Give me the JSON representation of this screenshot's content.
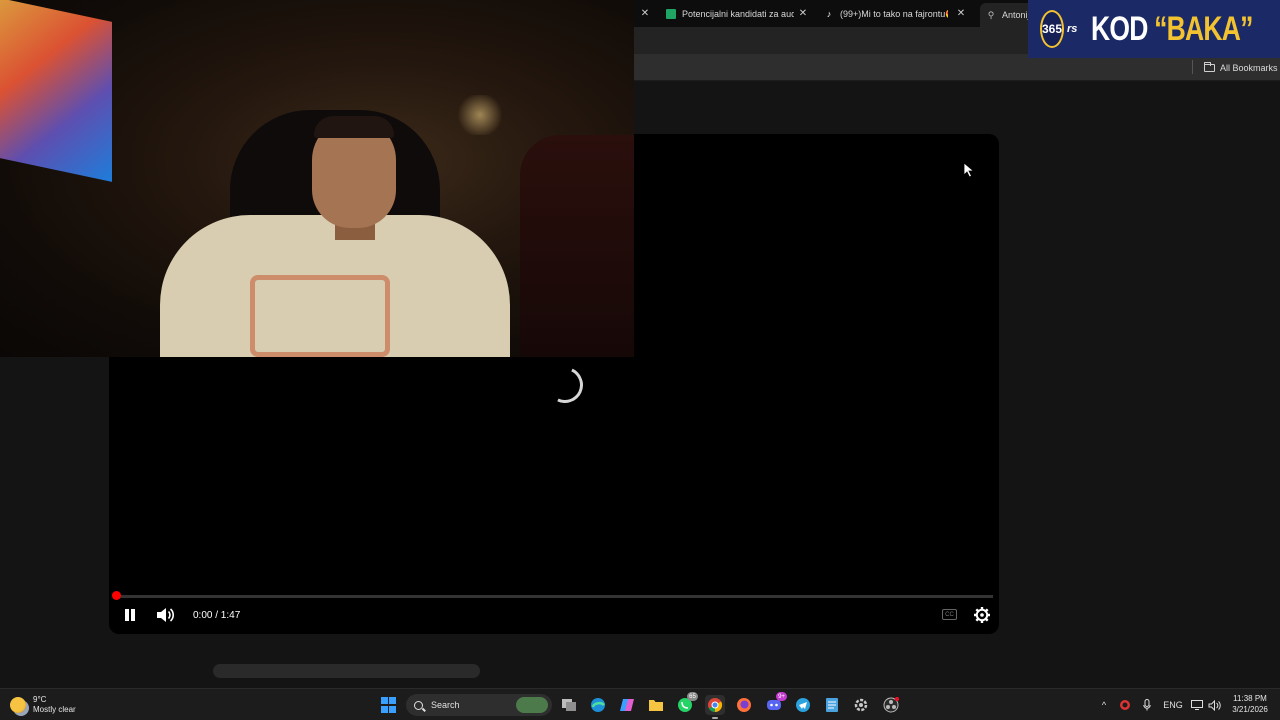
{
  "browser": {
    "tabs": [
      {
        "title": "Potencijalni kandidati za audicij",
        "icon": "google-sheets-icon"
      },
      {
        "title": "(99+)Mi to tako na fajrontu😍",
        "icon": "tiktok-icon"
      },
      {
        "title": "Antonijo",
        "icon": "link-icon"
      }
    ],
    "all_bookmarks_label": "All Bookmarks"
  },
  "brand": {
    "logo_number": "365",
    "logo_suffix": "rs",
    "title_white": "KOD ",
    "title_yellow": "“BAKA”",
    "colors": {
      "background": "#1b2a66",
      "accent": "#f2c230"
    }
  },
  "player": {
    "time_display": "0:00 / 1:47",
    "progress": 0.0,
    "state": "loading",
    "colors": {
      "progress": "#ff0000"
    },
    "controls": [
      "pause-icon",
      "volume-icon",
      "cc-icon",
      "settings-icon"
    ]
  },
  "taskbar": {
    "weather": {
      "temp": "9°C",
      "condition": "Mostly clear"
    },
    "search_label": "Search",
    "apps": [
      {
        "name": "task-view-icon"
      },
      {
        "name": "edge-icon"
      },
      {
        "name": "copilot-icon"
      },
      {
        "name": "file-explorer-icon"
      },
      {
        "name": "whatsapp-icon",
        "badge": "65"
      },
      {
        "name": "chrome-icon"
      },
      {
        "name": "firefox-icon"
      },
      {
        "name": "discord-icon",
        "badge": "9+"
      },
      {
        "name": "telegram-icon"
      },
      {
        "name": "notepad-icon"
      },
      {
        "name": "settings-app-icon"
      },
      {
        "name": "obs-icon"
      }
    ],
    "tray": {
      "language": "ENG",
      "time": "11:38 PM",
      "date": "3/21/2026"
    }
  }
}
